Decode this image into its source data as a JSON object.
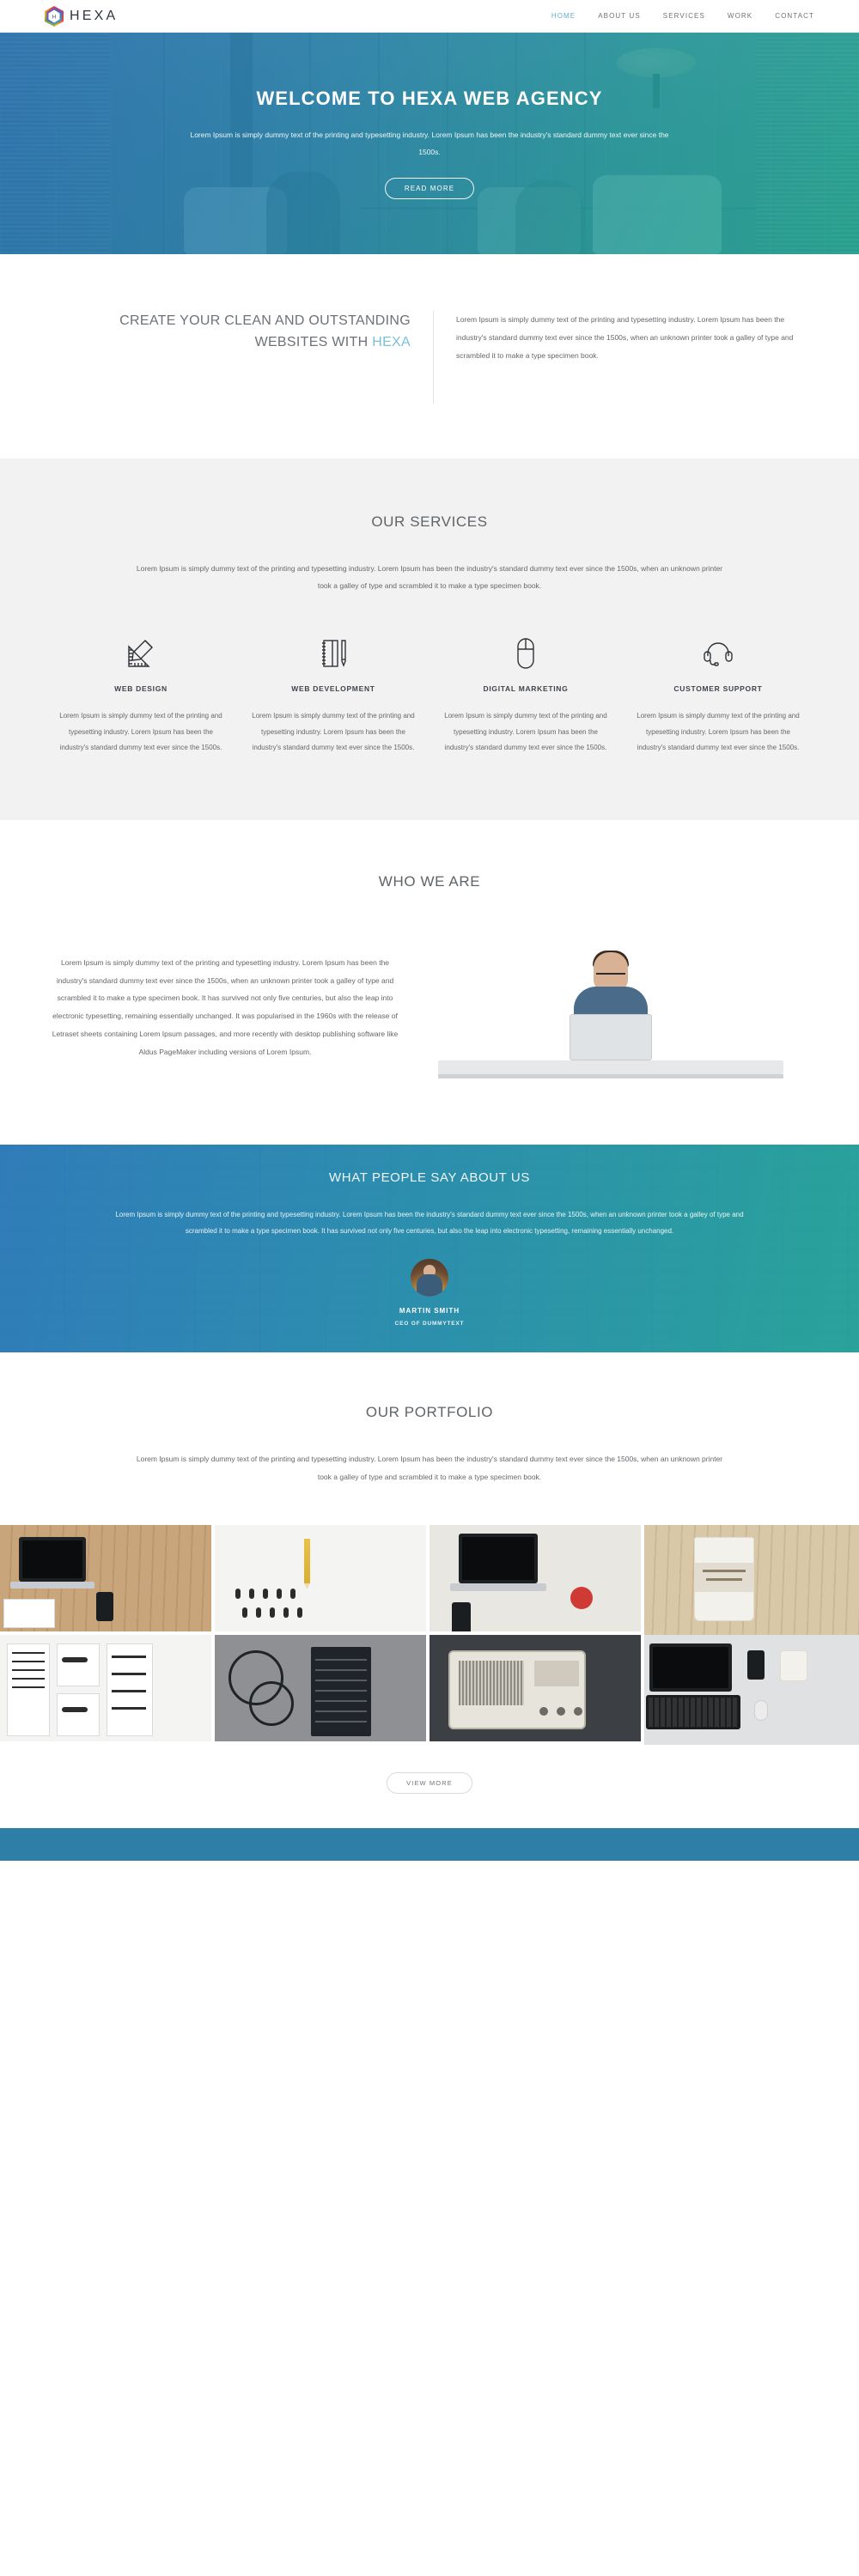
{
  "header": {
    "brand": "HEXA",
    "logo_icon": "hexagon-h-logo",
    "nav": [
      {
        "label": "HOME",
        "active": true
      },
      {
        "label": "ABOUT US",
        "active": false
      },
      {
        "label": "SERVICES",
        "active": false
      },
      {
        "label": "WORK",
        "active": false
      },
      {
        "label": "CONTACT",
        "active": false
      }
    ]
  },
  "hero": {
    "title": "WELCOME TO HEXA WEB AGENCY",
    "subtitle": "Lorem Ipsum is simply dummy text of the printing and typesetting industry. Lorem Ipsum has been the industry's standard dummy text ever since the 1500s.",
    "cta": "READ MORE"
  },
  "intro": {
    "heading_line1": "CREATE YOUR CLEAN AND OUTSTANDING",
    "heading_line2": "WEBSITES WITH ",
    "heading_accent": "HEXA",
    "body": "Lorem Ipsum is simply dummy text of the printing and typesetting industry. Lorem Ipsum has been the industry's standard dummy text ever since the 1500s, when an unknown printer took a galley of type and scrambled it to make a type specimen book."
  },
  "services": {
    "title": "OUR SERVICES",
    "lead": "Lorem Ipsum is simply dummy text of the printing and typesetting industry. Lorem Ipsum has been the industry's standard dummy text ever since the 1500s, when an unknown printer took a galley of type and scrambled it to make a type specimen book.",
    "items": [
      {
        "icon": "ruler-pencil-icon",
        "name": "WEB DESIGN",
        "text": "Lorem Ipsum is simply dummy text of the printing and typesetting industry. Lorem Ipsum has been the industry's standard dummy text ever since the 1500s."
      },
      {
        "icon": "notebook-pencil-icon",
        "name": "WEB DEVELOPMENT",
        "text": "Lorem Ipsum is simply dummy text of the printing and typesetting industry. Lorem Ipsum has been the industry's standard dummy text ever since the 1500s."
      },
      {
        "icon": "computer-mouse-icon",
        "name": "DIGITAL MARKETING",
        "text": "Lorem Ipsum is simply dummy text of the printing and typesetting industry. Lorem Ipsum has been the industry's standard dummy text ever since the 1500s."
      },
      {
        "icon": "headset-icon",
        "name": "CUSTOMER SUPPORT",
        "text": "Lorem Ipsum is simply dummy text of the printing and typesetting industry. Lorem Ipsum has been the industry's standard dummy text ever since the 1500s."
      }
    ]
  },
  "who_we_are": {
    "title": "WHO WE ARE",
    "body": "Lorem Ipsum is simply dummy text of the printing and typesetting industry. Lorem Ipsum has been the industry's standard dummy text ever since the 1500s, when an unknown printer took a galley of type and scrambled it to make a type specimen book. It has survived not only five centuries, but also the leap into electronic typesetting, remaining essentially unchanged. It was popularised in the 1960s with the release of Letraset sheets containing Lorem Ipsum passages, and more recently with desktop publishing software like Aldus PageMaker including versions of Lorem Ipsum.",
    "image_alt": "man-working-on-laptop-photo"
  },
  "testimonial": {
    "title": "WHAT PEOPLE SAY ABOUT US",
    "quote": "Lorem Ipsum is simply dummy text of the printing and typesetting industry. Lorem Ipsum has been the industry's standard dummy text ever since the 1500s, when an unknown printer took a galley of type and scrambled it to make a type specimen book. It has survived not only five centuries, but also the leap into electronic typesetting, remaining essentially unchanged.",
    "author_name": "MARTIN SMITH",
    "author_role": "CEO OF DUMMYTEXT",
    "avatar_alt": "martin-smith-avatar"
  },
  "portfolio": {
    "title": "OUR PORTFOLIO",
    "lead": "Lorem Ipsum is simply dummy text of the printing and typesetting industry. Lorem Ipsum has been the industry's standard dummy text ever since the 1500s, when an unknown printer took a galley of type and scrambled it to make a type specimen book.",
    "cta": "VIEW MORE",
    "items": [
      {
        "alt": "laptop-and-phone-on-wooden-desk"
      },
      {
        "alt": "pencil-and-paper-clips-on-white"
      },
      {
        "alt": "laptop-phone-and-red-apple"
      },
      {
        "alt": "riding-bicycle-coffee-cup"
      },
      {
        "alt": "black-and-white-design-sketches"
      },
      {
        "alt": "headphones-and-notepad-dark"
      },
      {
        "alt": "vintage-radio-receiver"
      },
      {
        "alt": "laptop-keyboard-mouse-coffee-workspace"
      }
    ]
  },
  "colors": {
    "accent": "#63b0cd",
    "hero_gradient_start": "#2670ad",
    "hero_gradient_end": "#23a68e",
    "footer_bar": "#2e7fa8",
    "services_bg": "#f2f2f2"
  }
}
